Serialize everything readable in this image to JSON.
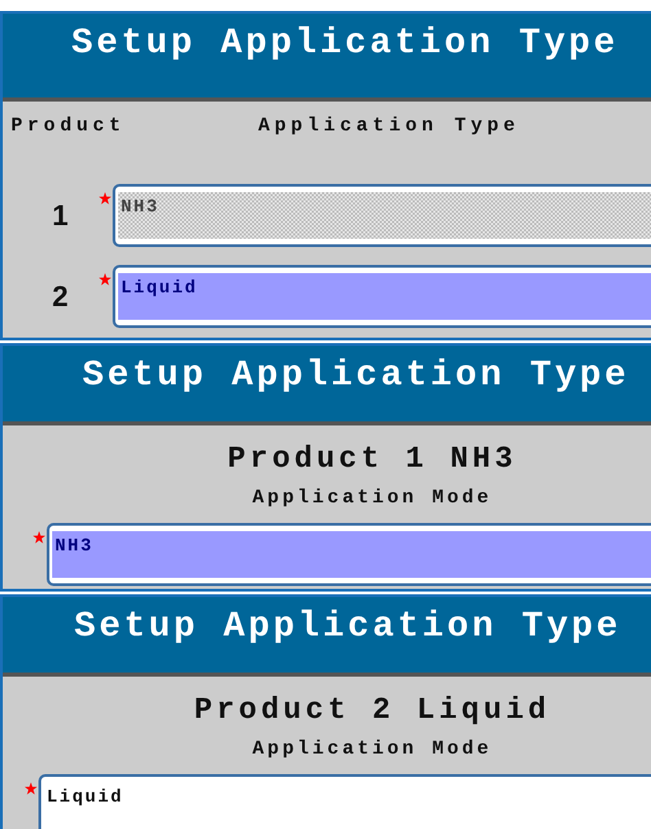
{
  "panels": [
    {
      "kind": "table",
      "title": "Setup Application Type",
      "columns": [
        "Product",
        "Application Type"
      ],
      "rows": [
        {
          "number": "1",
          "field": {
            "value": "NH3",
            "required": true,
            "disabled": true,
            "selected": false
          }
        },
        {
          "number": "2",
          "field": {
            "value": "Liquid",
            "required": true,
            "disabled": false,
            "selected": true
          }
        }
      ]
    },
    {
      "kind": "detail",
      "title": "Setup Application Type",
      "heading": "Product 1 NH3",
      "subheading": "Application Mode",
      "field": {
        "value": "NH3",
        "required": true,
        "disabled": false,
        "selected": true
      }
    },
    {
      "kind": "detail",
      "title": "Setup Application Type",
      "heading": "Product 2 Liquid",
      "subheading": "Application Mode",
      "field": {
        "value": "Liquid",
        "required": true,
        "disabled": false,
        "selected": false
      }
    }
  ]
}
